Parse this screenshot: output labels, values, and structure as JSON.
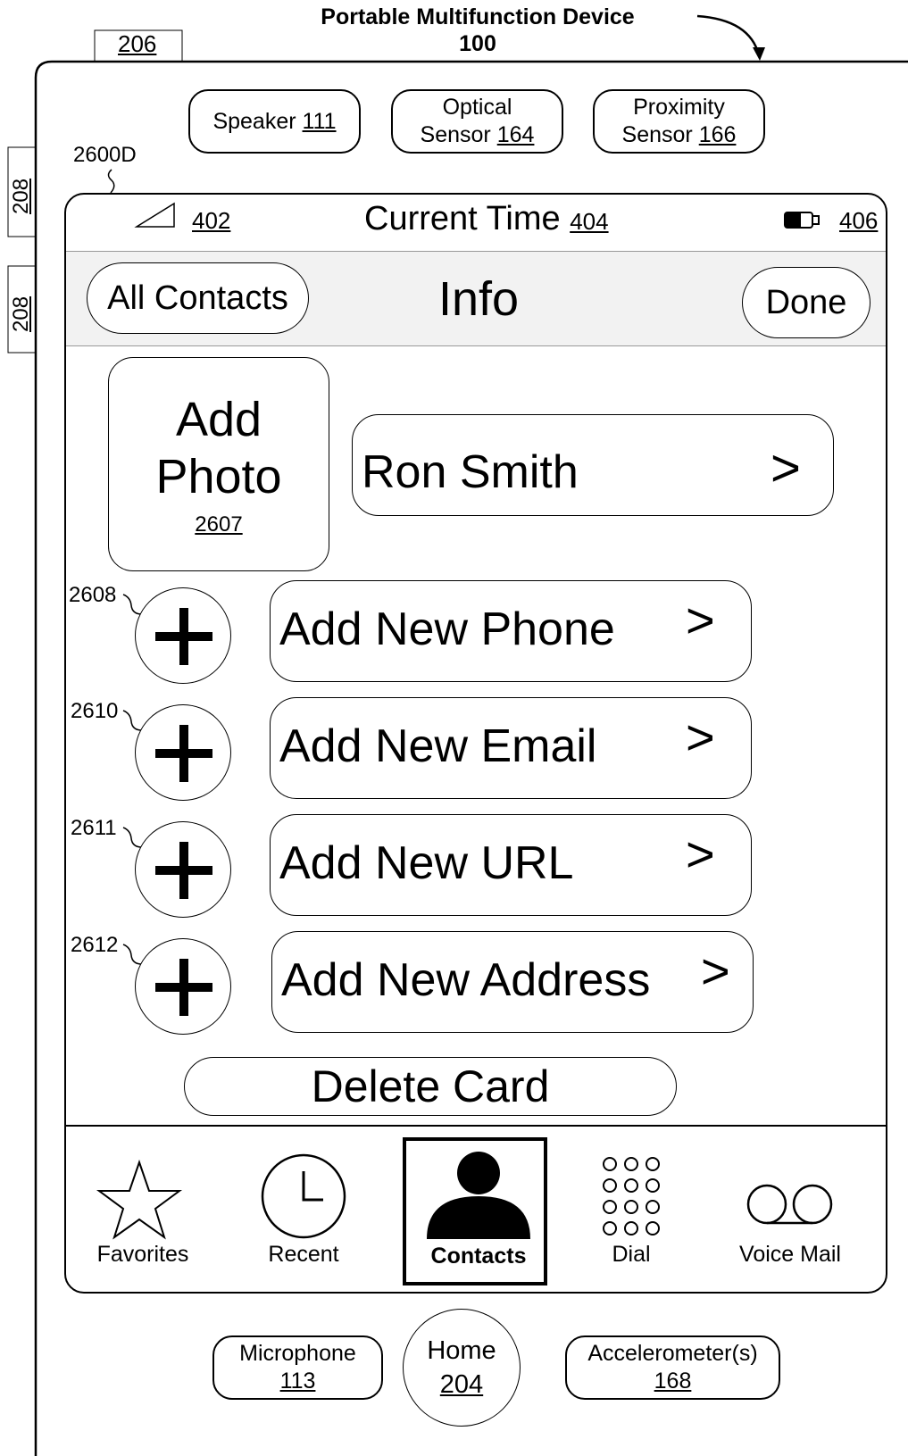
{
  "device": {
    "title": "Portable Multifunction Device",
    "number": "100"
  },
  "refs": {
    "top_tab": "206",
    "side_button_1": "208",
    "side_button_2": "208",
    "screen": "2600D"
  },
  "sensors": {
    "speaker": {
      "label": "Speaker",
      "number": "111"
    },
    "optical": {
      "line1": "Optical",
      "line2": "Sensor",
      "number": "164"
    },
    "proximity": {
      "line1": "Proximity",
      "line2": "Sensor",
      "number": "166"
    }
  },
  "status_bar": {
    "signal_ref": "402",
    "time_label": "Current Time",
    "time_ref": "404",
    "battery_ref": "406"
  },
  "nav_bar": {
    "back_label": "All Contacts",
    "title": "Info",
    "done_label": "Done"
  },
  "photo": {
    "line1": "Add",
    "line2": "Photo",
    "ref": "2607"
  },
  "name_row": {
    "label": "Ron Smith",
    "chevron": ">"
  },
  "add_rows": [
    {
      "ref": "2608",
      "label": "Add New Phone",
      "chevron": ">"
    },
    {
      "ref": "2610",
      "label": "Add New Email",
      "chevron": ">"
    },
    {
      "ref": "2611",
      "label": "Add New URL",
      "chevron": ">"
    },
    {
      "ref": "2612",
      "label": "Add New Address",
      "chevron": ">"
    }
  ],
  "delete_label": "Delete Card",
  "tab_bar": {
    "active": "Contacts",
    "tabs": [
      {
        "label": "Favorites",
        "icon": "star-icon"
      },
      {
        "label": "Recent",
        "icon": "clock-icon"
      },
      {
        "label": "Contacts",
        "icon": "person-icon"
      },
      {
        "label": "Dial",
        "icon": "keypad-icon"
      },
      {
        "label": "Voice Mail",
        "icon": "voicemail-icon"
      }
    ]
  },
  "hardware_bottom": {
    "microphone": {
      "label": "Microphone",
      "number": "113"
    },
    "home": {
      "label": "Home",
      "number": "204"
    },
    "accelerometer": {
      "label": "Accelerometer(s)",
      "number": "168"
    }
  }
}
